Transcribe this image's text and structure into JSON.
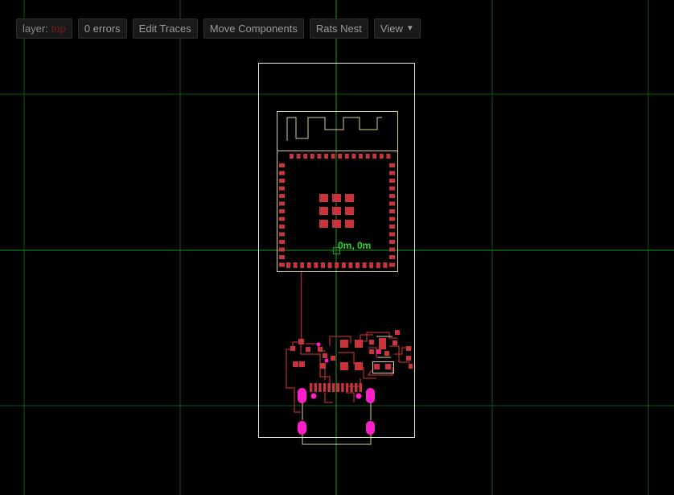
{
  "toolbar": {
    "layer_label": "layer:",
    "layer_value": "top",
    "errors_label": "0 errors",
    "edit_traces_label": "Edit Traces",
    "move_components_label": "Move Components",
    "rats_nest_label": "Rats Nest",
    "view_label": "View",
    "view_caret": "▼"
  },
  "canvas": {
    "origin_label": "0m, 0m"
  },
  "colors": {
    "background": "#000000",
    "grid": "#0b6b0b",
    "axis": "#1faa1f",
    "origin_text": "#22dd22",
    "copper": "#c8343a",
    "trace": "#b02a30",
    "silkscreen": "#d8cf9a",
    "board_outline": "#e8e8e8",
    "plated_hole": "#ff1fc8"
  }
}
